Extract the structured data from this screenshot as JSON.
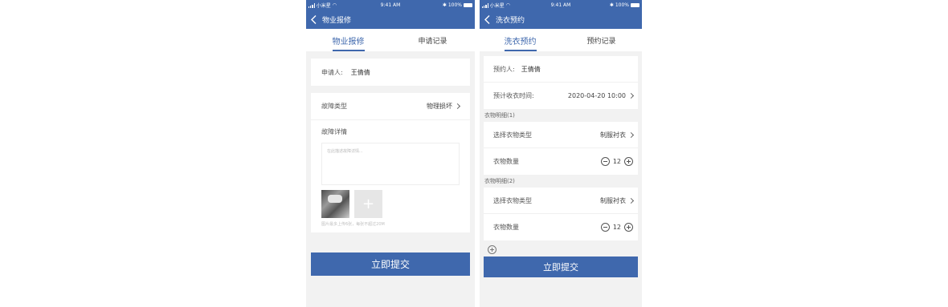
{
  "colors": {
    "primary": "#3f68ad",
    "background": "#f2f2f2"
  },
  "repair": {
    "status": {
      "carrier": "小米星",
      "time": "9:41 AM",
      "battery": "100%"
    },
    "title": "物业报修",
    "tabs": [
      {
        "label": "物业报修",
        "active": true
      },
      {
        "label": "申请记录",
        "active": false
      }
    ],
    "applicant": {
      "label": "申请人:",
      "value": "王倩倩"
    },
    "fault_type": {
      "label": "故障类型",
      "value": "物理损坏"
    },
    "fault_detail": {
      "label": "故障详情",
      "placeholder": "在此描述故障详情..."
    },
    "photo_hint": "图片最多上传6张，每张不超过20M",
    "add_icon": "plus-icon",
    "submit_label": "立即提交"
  },
  "laundry": {
    "status": {
      "carrier": "小米星",
      "time": "9:41 AM",
      "battery": "100%"
    },
    "title": "洗衣预约",
    "tabs": [
      {
        "label": "洗衣预约",
        "active": true
      },
      {
        "label": "预约记录",
        "active": false
      }
    ],
    "reserver": {
      "label": "预约人:",
      "value": "王倩倩"
    },
    "pickup_time": {
      "label": "预计收衣时间:",
      "value": "2020-04-20 10:00"
    },
    "groups": [
      {
        "header": "衣物明细(1)",
        "type_label": "选择衣物类型",
        "type_value": "制服衬衣",
        "qty_label": "衣物数量",
        "qty": "12"
      },
      {
        "header": "衣物明细(2)",
        "type_label": "选择衣物类型",
        "type_value": "制服衬衣",
        "qty_label": "衣物数量",
        "qty": "12"
      }
    ],
    "add_group_icon": "add-circle-icon",
    "submit_label": "立即提交"
  }
}
